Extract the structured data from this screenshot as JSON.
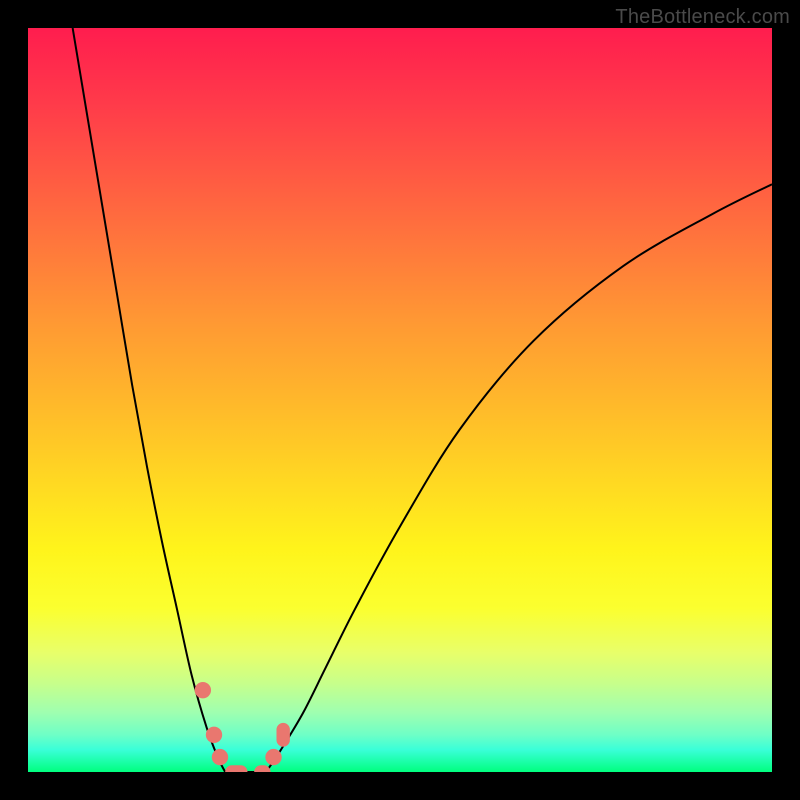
{
  "watermark": "TheBottleneck.com",
  "colors": {
    "curve": "#000000",
    "markers": "#e9776f",
    "frame_bg_top": "#ff1d4e",
    "frame_bg_bottom": "#00ff7f",
    "page_bg": "#000000"
  },
  "chart_data": {
    "type": "line",
    "title": "",
    "xlabel": "",
    "ylabel": "",
    "xlim": [
      0,
      100
    ],
    "ylim": [
      0,
      100
    ],
    "grid": false,
    "legend": false,
    "series": [
      {
        "name": "left-branch",
        "x": [
          6,
          8,
          10,
          12,
          14,
          16,
          18,
          20,
          22,
          24,
          25.5,
          26.5
        ],
        "y": [
          100,
          88,
          76,
          64,
          52,
          41,
          31,
          22,
          13,
          6,
          2,
          0
        ]
      },
      {
        "name": "floor",
        "x": [
          26.5,
          32
        ],
        "y": [
          0,
          0
        ]
      },
      {
        "name": "right-branch",
        "x": [
          32,
          34,
          37,
          40,
          44,
          50,
          58,
          68,
          80,
          92,
          100
        ],
        "y": [
          0,
          3,
          8,
          14,
          22,
          33,
          46,
          58,
          68,
          75,
          79
        ]
      }
    ],
    "markers": [
      {
        "shape": "dot",
        "x": 23.5,
        "y": 11,
        "r": 1.1
      },
      {
        "shape": "dot",
        "x": 25.0,
        "y": 5,
        "r": 1.1
      },
      {
        "shape": "dot",
        "x": 25.8,
        "y": 2,
        "r": 1.1
      },
      {
        "shape": "dot",
        "x": 33.0,
        "y": 2,
        "r": 1.1
      },
      {
        "shape": "pill",
        "x": 28.0,
        "y": 0,
        "w": 3.0,
        "h": 1.8
      },
      {
        "shape": "pill",
        "x": 31.5,
        "y": 0,
        "w": 2.2,
        "h": 1.8
      },
      {
        "shape": "pill",
        "x": 34.3,
        "y": 5,
        "w": 1.8,
        "h": 3.2
      }
    ]
  }
}
